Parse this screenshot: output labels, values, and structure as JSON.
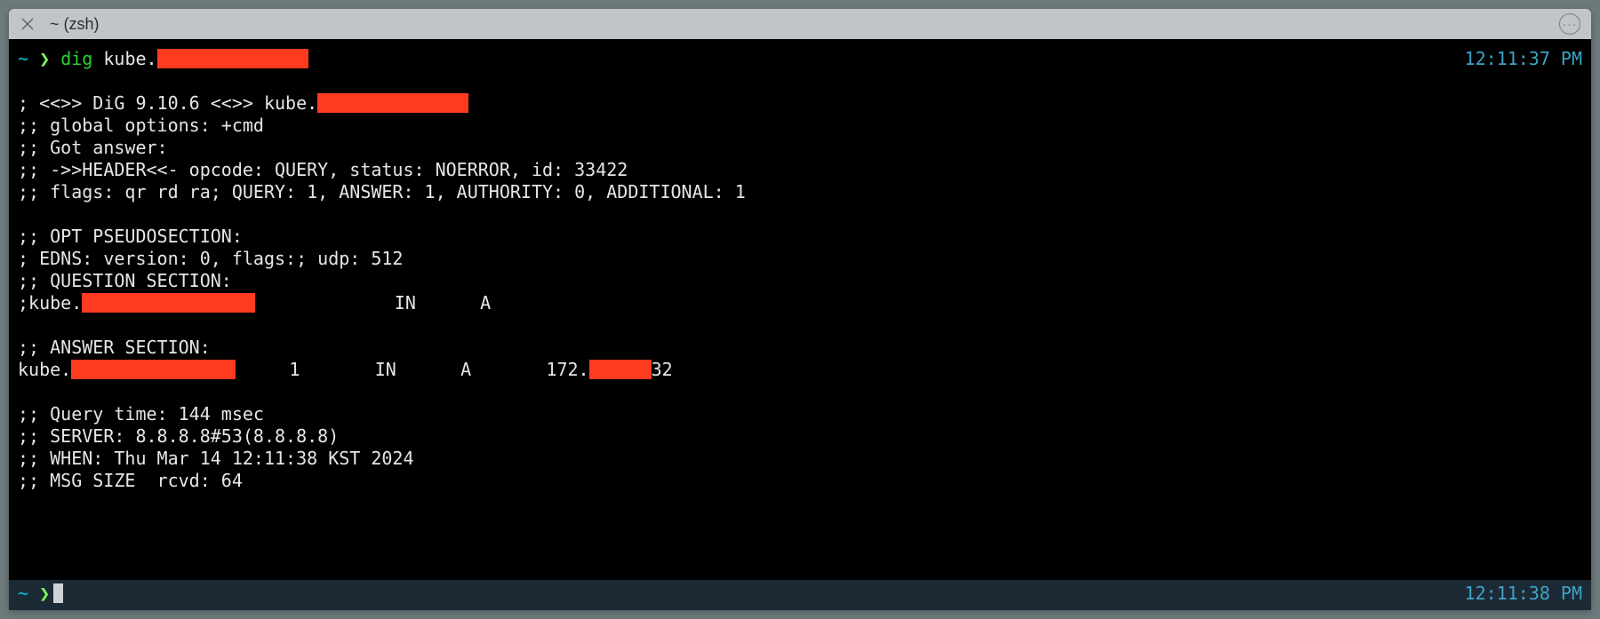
{
  "titlebar": {
    "title": "~ (zsh)"
  },
  "prompt": {
    "tilde": "~",
    "arrow": "❯"
  },
  "cmd": {
    "prog": "dig",
    "arg_prefix": "kube."
  },
  "time1": "12:11:37 PM",
  "time2": "12:11:38 PM",
  "out": {
    "banner_pre": "; <<>> DiG 9.10.6 <<>> kube.",
    "global_opts": ";; global options: +cmd",
    "got_answer": ";; Got answer:",
    "header": ";; ->>HEADER<<- opcode: QUERY, status: NOERROR, id: 33422",
    "flags": ";; flags: qr rd ra; QUERY: 1, ANSWER: 1, AUTHORITY: 0, ADDITIONAL: 1",
    "opt_hdr": ";; OPT PSEUDOSECTION:",
    "edns": "; EDNS: version: 0, flags:; udp: 512",
    "question_hdr": ";; QUESTION SECTION:",
    "question_pre": ";kube.",
    "question_post": "             IN      A",
    "answer_hdr": ";; ANSWER SECTION:",
    "answer_pre": "kube.",
    "answer_mid": "     1       IN      A       172.",
    "answer_post": "32",
    "qtime": ";; Query time: 144 msec",
    "server": ";; SERVER: 8.8.8.8#53(8.8.8.8)",
    "when": ";; WHEN: Thu Mar 14 12:11:38 KST 2024",
    "msgsize": ";; MSG SIZE  rcvd: 64"
  }
}
